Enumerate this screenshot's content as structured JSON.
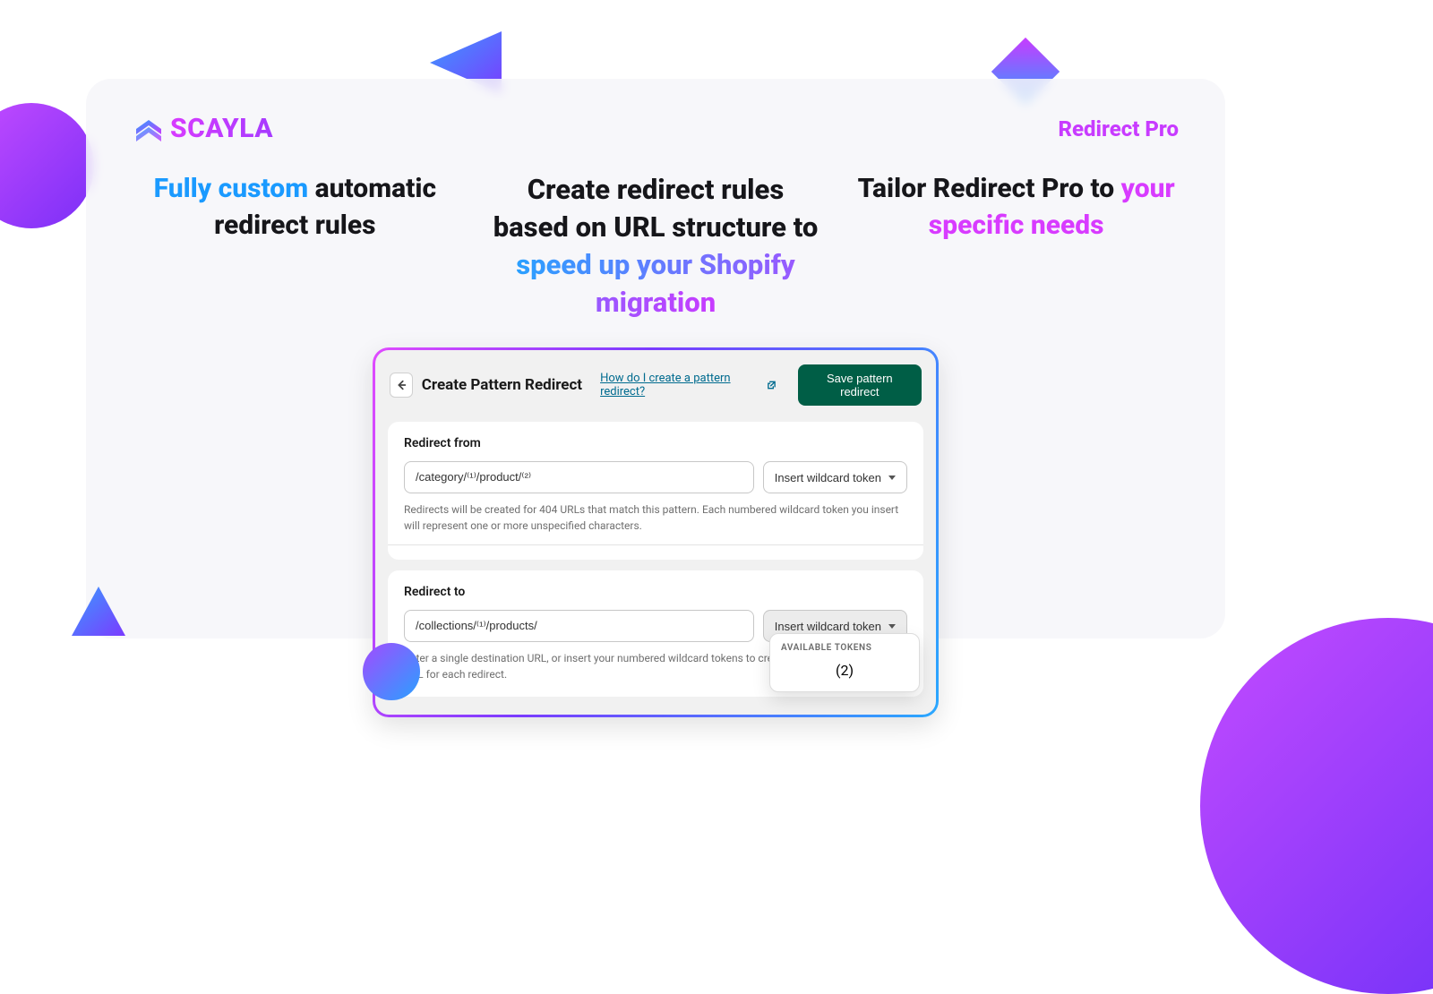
{
  "brand": {
    "name": "SCAYLA"
  },
  "product_name": "Redirect Pro",
  "headlines": {
    "left_accent": "Fully custom",
    "left_rest": "automatic redirect rules",
    "mid_pre": "Create redirect rules based on URL structure to ",
    "mid_accent": "speed up your Shopify migration",
    "right_pre": "Tailor Redirect Pro to ",
    "right_accent": "your specific needs"
  },
  "panel": {
    "title": "Create Pattern Redirect",
    "help_link": "How do I create a pattern redirect?",
    "save_button": "Save pattern redirect",
    "redirect_from": {
      "label": "Redirect from",
      "value": "/category/⁽¹⁾/product/⁽²⁾",
      "token_button": "Insert wildcard token",
      "hint": "Redirects will be created for 404 URLs that match this pattern. Each numbered wildcard token you insert will represent one or more unspecified characters."
    },
    "redirect_to": {
      "label": "Redirect to",
      "value": "/collections/⁽¹⁾/products/",
      "token_button": "Insert wildcard token",
      "hint": "Enter a single destination URL, or insert your numbered wildcard tokens to create a unique destination URL for each redirect."
    },
    "dropdown": {
      "header": "AVAILABLE TOKENS",
      "item": "(2)"
    }
  }
}
